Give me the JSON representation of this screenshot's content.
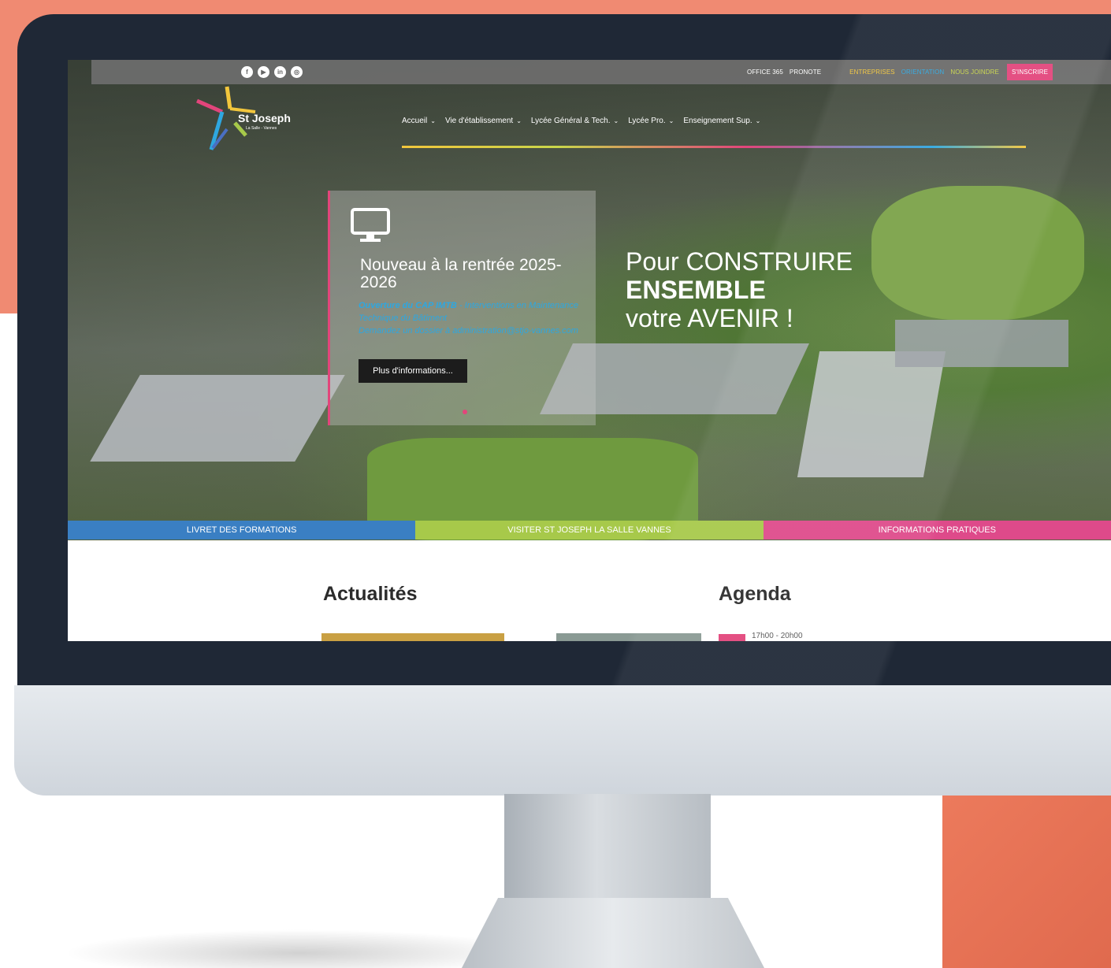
{
  "topbar": {
    "social": [
      "facebook-icon",
      "youtube-icon",
      "linkedin-icon",
      "instagram-icon"
    ],
    "links": [
      {
        "label": "OFFICE 365",
        "color": "#ffffff"
      },
      {
        "label": "PRONOTE",
        "color": "#ffffff"
      },
      {
        "label": "ENTREPRISES",
        "color": "#f2c63c"
      },
      {
        "label": "ORIENTATION",
        "color": "#2ea7e0"
      },
      {
        "label": "NOUS JOINDRE",
        "color": "#c9d64a"
      }
    ],
    "cta": "S'INSCRIRE"
  },
  "logo": {
    "text": "St Joseph",
    "sub": "La Salle - Vannes"
  },
  "nav": {
    "items": [
      {
        "label": "Accueil"
      },
      {
        "label": "Vie d'établissement"
      },
      {
        "label": "Lycée Général & Tech."
      },
      {
        "label": "Lycée Pro."
      },
      {
        "label": "Enseignement Sup."
      }
    ]
  },
  "slide": {
    "icon": "monitor-icon",
    "title": "Nouveau à la rentrée 2025-2026",
    "text_bold": "Ouverture du CAP IMTB",
    "text_rest": " - Interventions en Maintenance Technique du Bâtiment",
    "text_contact": "Demandez un dossier à administration@stjo-vannes.com",
    "button": "Plus d'informations..."
  },
  "headline": {
    "line1": "Pour CONSTRUIRE",
    "line2": "ENSEMBLE",
    "line3": "votre AVENIR !"
  },
  "bars": [
    {
      "label": "LIVRET DES FORMATIONS",
      "color": "#3a7fc3"
    },
    {
      "label": "VISITER ST JOSEPH LA SALLE VANNES",
      "color": "#a7c94a"
    },
    {
      "label": "INFORMATIONS PRATIQUES",
      "color": "#de4a8a"
    }
  ],
  "content": {
    "news_title": "Actualités",
    "agenda_title": "Agenda",
    "agenda_time": "17h00 - 20h00"
  }
}
